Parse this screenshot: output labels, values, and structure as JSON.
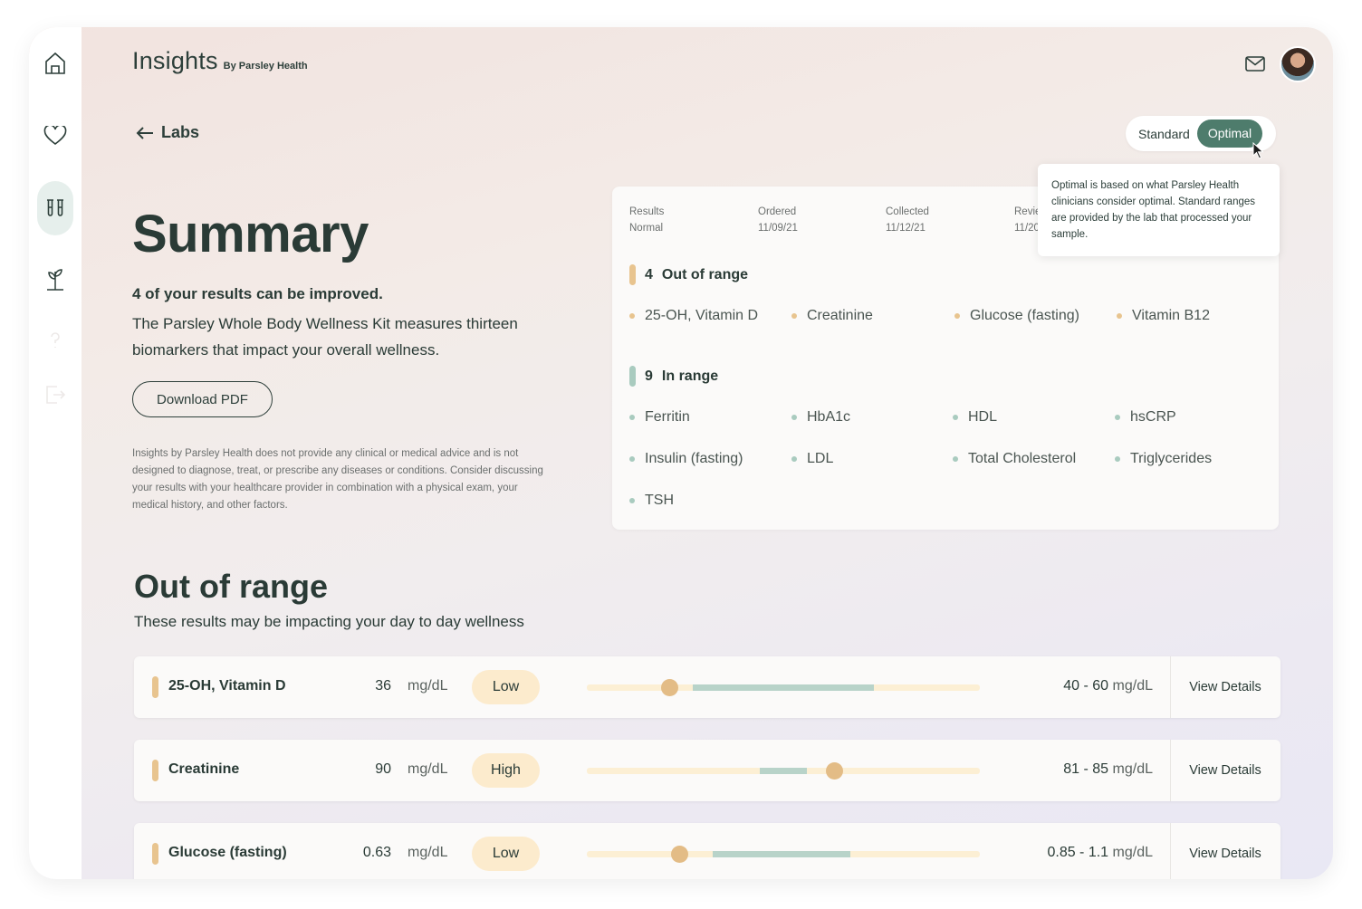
{
  "app": {
    "title": "Insights",
    "subtitle": "By Parsley Health"
  },
  "sidebar": {
    "items": [
      {
        "name": "home-icon",
        "active": false
      },
      {
        "name": "heart-icon",
        "active": false
      },
      {
        "name": "lab-tubes-icon",
        "active": true
      },
      {
        "name": "plant-icon",
        "active": false
      },
      {
        "name": "help-icon",
        "active": false
      },
      {
        "name": "logout-icon",
        "active": false
      }
    ]
  },
  "header": {
    "back_label": "Labs"
  },
  "toggle": {
    "standard": "Standard",
    "optimal": "Optimal",
    "selected": "Optimal"
  },
  "tooltip": {
    "text": "Optimal is based on what Parsley Health clinicians consider optimal. Standard ranges are provided by the lab that processed your sample."
  },
  "summary": {
    "title": "Summary",
    "lead": "4 of your results can be improved.",
    "description": "The Parsley Whole Body Wellness Kit measures thirteen biomarkers that impact your overall wellness.",
    "download_label": "Download PDF",
    "disclaimer": "Insights by Parsley Health does not provide any clinical or medical advice and is not designed to diagnose, treat, or prescribe any diseases or conditions. Consider discussing your results with your healthcare provider in combination with a physical exam, your medical history, and other factors."
  },
  "results_card": {
    "meta": [
      {
        "label": "Results",
        "value": "Normal"
      },
      {
        "label": "Ordered",
        "value": "11/09/21"
      },
      {
        "label": "Collected",
        "value": "11/12/21"
      },
      {
        "label": "Revie",
        "value": "11/20"
      }
    ],
    "out_of_range": {
      "count": "4",
      "label": "Out of range",
      "items": [
        "25-OH, Vitamin D",
        "Creatinine",
        "Glucose (fasting)",
        "Vitamin B12"
      ]
    },
    "in_range": {
      "count": "9",
      "label": "In range",
      "items": [
        "Ferritin",
        "HbA1c",
        "HDL",
        "hsCRP",
        "Insulin (fasting)",
        "LDL",
        "Total Cholesterol",
        "Triglycerides",
        "TSH"
      ]
    }
  },
  "out_of_range_section": {
    "title": "Out of range",
    "subtitle": "These results may be impacting your day to day wellness",
    "rows": [
      {
        "name": "25-OH, Vitamin D",
        "value": "36",
        "unit": "mg/dL",
        "status": "Low",
        "range": "40 - 60",
        "range_unit": "mg/dL",
        "link": "View Details",
        "range_start": 0.27,
        "range_end": 0.73,
        "marker": 0.21
      },
      {
        "name": "Creatinine",
        "value": "90",
        "unit": "mg/dL",
        "status": "High",
        "range": "81 - 85",
        "range_unit": "mg/dL",
        "link": "View Details",
        "range_start": 0.44,
        "range_end": 0.56,
        "marker": 0.63
      },
      {
        "name": "Glucose (fasting)",
        "value": "0.63",
        "unit": "mg/dL",
        "status": "Low",
        "range": "0.85 - 1.1",
        "range_unit": "mg/dL",
        "link": "View Details",
        "range_start": 0.32,
        "range_end": 0.67,
        "marker": 0.235
      }
    ]
  },
  "colors": {
    "accent": "#4e7c6c",
    "out_of_range": "#e8c48f",
    "in_range": "#a9cbbf",
    "badge": "#fcebcd"
  }
}
